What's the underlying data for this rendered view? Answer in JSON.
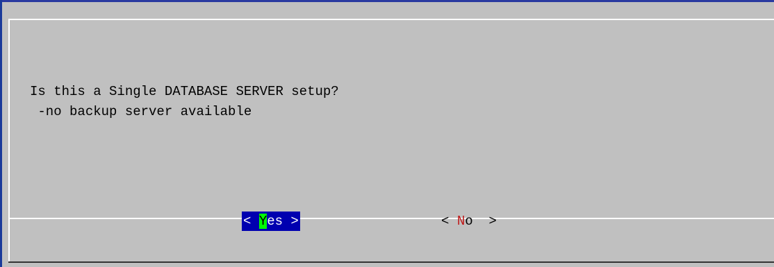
{
  "dialog": {
    "message_line1": "Is this a Single DATABASE SERVER setup?",
    "message_line2": " -no backup server available"
  },
  "buttons": {
    "yes": {
      "open": "< ",
      "hotkey": "Y",
      "rest": "es >"
    },
    "no": {
      "open": "< ",
      "hotkey": "N",
      "rest": "o  >"
    }
  },
  "colors": {
    "background": "#c0c0c0",
    "selected_button_bg": "#0000b0",
    "selected_hotkey_bg": "#00ff00",
    "hotkey_text": "#c01818"
  }
}
